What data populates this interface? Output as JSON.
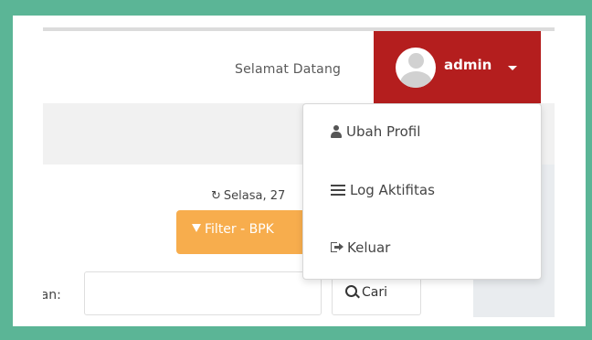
{
  "header": {
    "welcome_text": "Selamat Datang",
    "user_name": "admin"
  },
  "user_dropdown": {
    "items": [
      {
        "label": "Ubah Profil",
        "icon": "user-icon"
      },
      {
        "label": "Log Aktifitas",
        "icon": "list-icon"
      },
      {
        "label": "Keluar",
        "icon": "sign-out-icon"
      }
    ]
  },
  "main": {
    "date_text": "Selasa, 27",
    "filter_button_label": "Filter - BPK",
    "search_label": "rian:",
    "search_value": "",
    "search_button_label": "Cari"
  },
  "colors": {
    "frame": "#5bb596",
    "user_menu": "#b41e1e",
    "filter_button": "#f7ad4d"
  }
}
